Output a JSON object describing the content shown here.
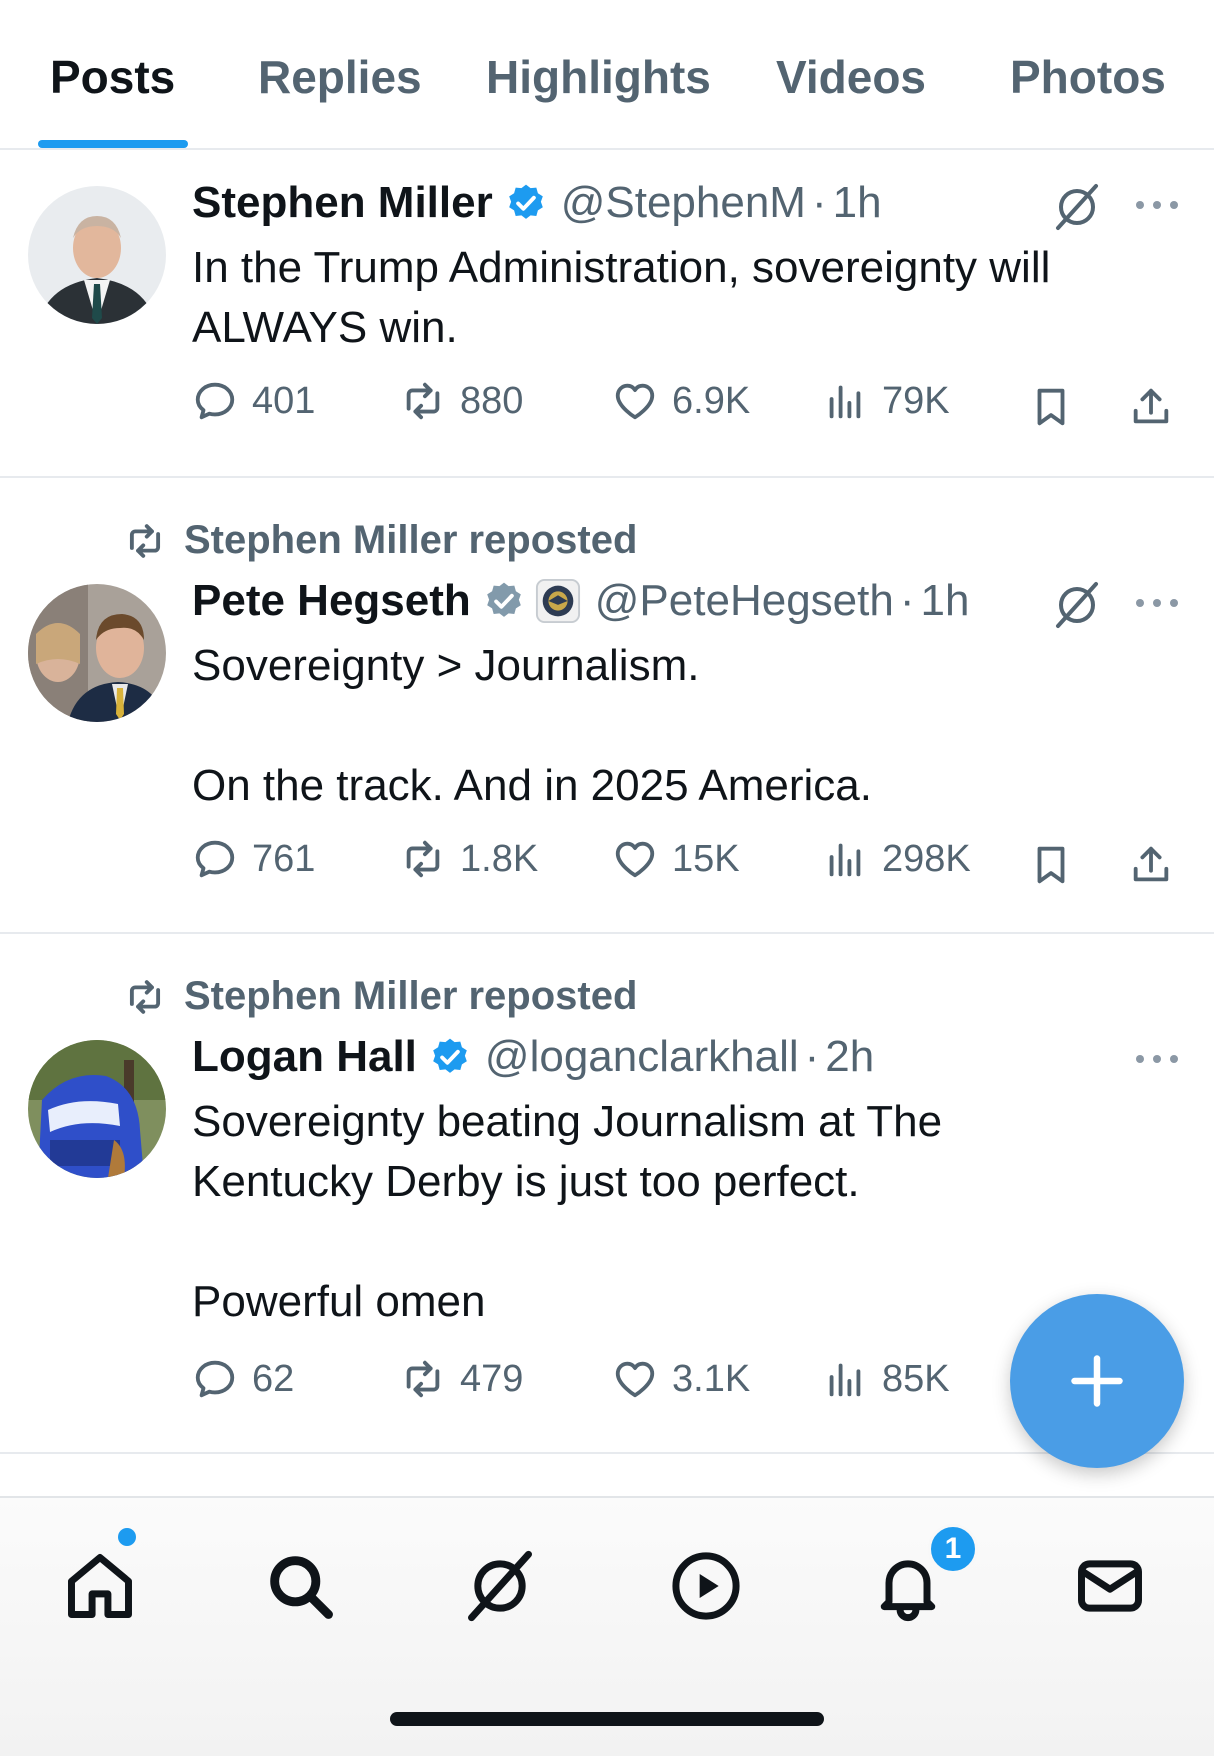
{
  "tabs": [
    {
      "label": "Posts",
      "active": true
    },
    {
      "label": "Replies"
    },
    {
      "label": "Highlights"
    },
    {
      "label": "Videos"
    },
    {
      "label": "Photos"
    }
  ],
  "posts": [
    {
      "author": "Stephen Miller",
      "verified": true,
      "handle": "@StephenM",
      "time": "1h",
      "text": "In the Trump Administration, sovereignty will\nALWAYS win.",
      "replies": "401",
      "reposts": "880",
      "likes": "6.9K",
      "views": "79K"
    },
    {
      "repost_label": "Stephen Miller reposted",
      "author": "Pete Hegseth",
      "verified": true,
      "affiliation_icon": "department-seal-icon",
      "handle": "@PeteHegseth",
      "time": "1h",
      "text": "Sovereignty > Journalism.\n\nOn the track. And in 2025 America.",
      "replies": "761",
      "reposts": "1.8K",
      "likes": "15K",
      "views": "298K"
    },
    {
      "repost_label": "Stephen Miller reposted",
      "author": "Logan Hall",
      "verified": true,
      "handle": "@loganclarkhall",
      "time": "2h",
      "text": "Sovereignty beating Journalism at The\nKentucky Derby is just too perfect.\n\nPowerful omen",
      "replies": "62",
      "reposts": "479",
      "likes": "3.1K",
      "views": "85K"
    }
  ],
  "separator": "·",
  "bottom_nav": {
    "items": [
      "home-icon",
      "search-icon",
      "grok-icon",
      "video-icon",
      "notifications-icon",
      "messages-icon"
    ],
    "notifications_badge": "1"
  },
  "colors": {
    "accent": "#1d9bf0",
    "text": "#0f1419",
    "secondary": "#536471",
    "fab": "#4a9de6"
  }
}
